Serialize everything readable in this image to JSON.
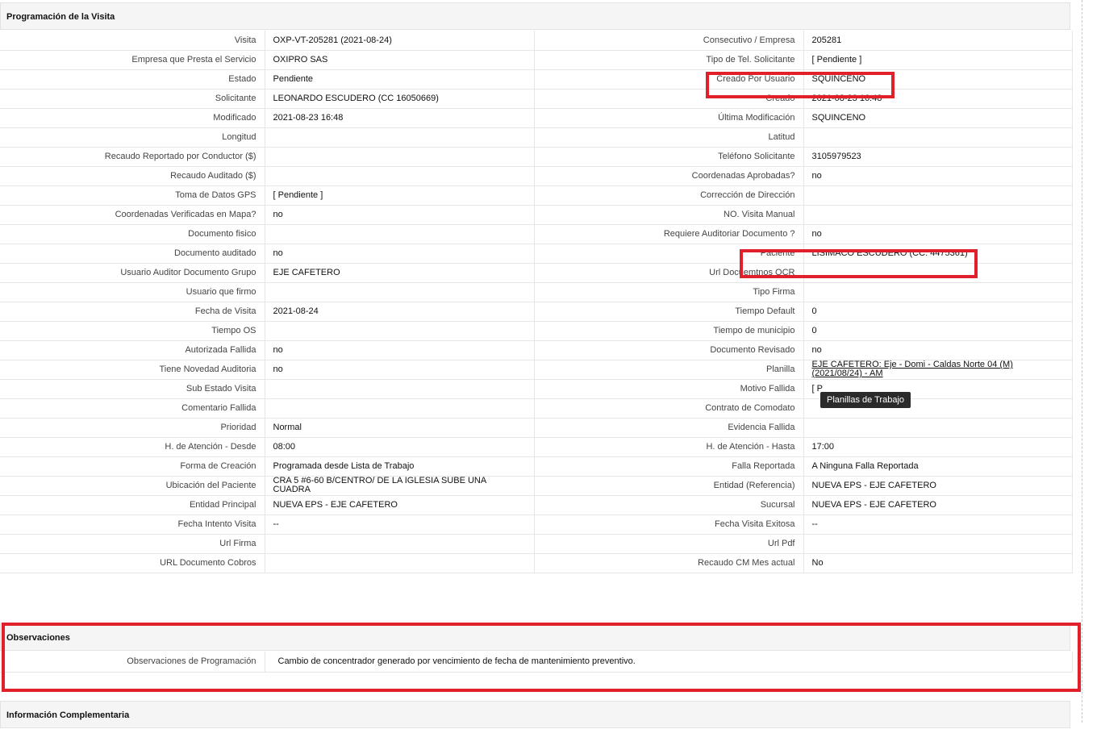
{
  "section_programacion": {
    "title": "Programación de la Visita"
  },
  "rows": [
    {
      "l1": "Visita",
      "v1": "OXP-VT-205281 (2021-08-24)",
      "l2": "Consecutivo / Empresa",
      "v2": "205281"
    },
    {
      "l1": "Empresa que Presta el Servicio",
      "v1": "OXIPRO SAS",
      "l2": "Tipo de Tel. Solicitante",
      "v2": "[ Pendiente ]"
    },
    {
      "l1": "Estado",
      "v1": "Pendiente",
      "l2": "Creado Por Usuario",
      "v2": "SQUINCENO"
    },
    {
      "l1": "Solicitante",
      "v1": "LEONARDO ESCUDERO (CC 16050669)",
      "l2": "Creado",
      "v2": "2021-08-23 16:48"
    },
    {
      "l1": "Modificado",
      "v1": "2021-08-23 16:48",
      "l2": "Última Modificación",
      "v2": " SQUINCENO"
    },
    {
      "l1": "Longitud",
      "v1": "",
      "l2": "Latitud",
      "v2": ""
    },
    {
      "l1": "Recaudo Reportado por Conductor ($)",
      "v1": "",
      "l2": "Teléfono Solicitante",
      "v2": "3105979523"
    },
    {
      "l1": "Recaudo Auditado ($)",
      "v1": "",
      "l2": "Coordenadas Aprobadas?",
      "v2": " no"
    },
    {
      "l1": "Toma de Datos GPS",
      "v1": "[ Pendiente ]",
      "l2": "Corrección de Dirección",
      "v2": ""
    },
    {
      "l1": "Coordenadas Verificadas en Mapa?",
      "v1": " no",
      "l2": "NO. Visita Manual",
      "v2": ""
    },
    {
      "l1": "Documento fisico",
      "v1": "",
      "l2": "Requiere Auditoriar Documento ?",
      "v2": " no"
    },
    {
      "l1": "Documento auditado",
      "v1": " no",
      "l2": "Paciente",
      "v2": "LISIMACO ESCUDERO (CC: 4475361)"
    },
    {
      "l1": "Usuario Auditor Documento Grupo",
      "v1": "EJE CAFETERO",
      "l2": "Url Docuemtnos OCR",
      "v2": ""
    },
    {
      "l1": "Usuario que firmo",
      "v1": "",
      "l2": "Tipo Firma",
      "v2": ""
    },
    {
      "l1": "Fecha de Visita",
      "v1": " 2021-08-24",
      "l2": "Tiempo Default",
      "v2": "0"
    },
    {
      "l1": "Tiempo OS",
      "v1": "",
      "l2": "Tiempo de municipio",
      "v2": "0"
    },
    {
      "l1": "Autorizada Fallida",
      "v1": " no",
      "l2": "Documento Revisado",
      "v2": " no"
    },
    {
      "l1": "Tiene Novedad Auditoria",
      "v1": " no",
      "l2": "Planilla",
      "v2": "EJE CAFETERO: Eje - Domi - Caldas Norte 04 (M) (2021/08/24) - AM"
    },
    {
      "l1": "Sub Estado Visita",
      "v1": "",
      "l2": "Motivo Fallida",
      "v2": "[ P"
    },
    {
      "l1": "Comentario Fallida",
      "v1": "",
      "l2": "Contrato de Comodato",
      "v2": ""
    },
    {
      "l1": "Prioridad",
      "v1": "Normal",
      "l2": "Evidencia Fallida",
      "v2": ""
    },
    {
      "l1": "H. de Atención - Desde",
      "v1": "08:00",
      "l2": "H. de Atención - Hasta",
      "v2": "17:00"
    },
    {
      "l1": "Forma de Creación",
      "v1": "Programada desde Lista de Trabajo",
      "l2": "Falla Reportada",
      "v2": "A Ninguna Falla Reportada"
    },
    {
      "l1": "Ubicación del Paciente",
      "v1": "CRA 5 #6-60 B/CENTRO/ DE LA IGLESIA SUBE UNA CUADRA",
      "l2": "Entidad (Referencia)",
      "v2": "NUEVA EPS - EJE CAFETERO"
    },
    {
      "l1": "Entidad Principal",
      "v1": "NUEVA EPS - EJE CAFETERO",
      "l2": "Sucursal",
      "v2": "NUEVA EPS - EJE CAFETERO"
    },
    {
      "l1": "Fecha Intento Visita",
      "v1": " --",
      "l2": "Fecha Visita Exitosa",
      "v2": " --"
    },
    {
      "l1": "Url Firma",
      "v1": "",
      "l2": "Url Pdf",
      "v2": ""
    },
    {
      "l1": "URL Documento Cobros",
      "v1": "",
      "l2": "Recaudo CM Mes actual",
      "v2": "No"
    }
  ],
  "tooltip": {
    "text": "Planillas de Trabajo"
  },
  "section_observaciones": {
    "title": "Observaciones",
    "label": "Observaciones de Programación",
    "value": "Cambio de concentrador generado por vencimiento de fecha de mantenimiento preventivo."
  },
  "section_info": {
    "title": "Información Complementaria"
  },
  "colors": {
    "highlight": "#e0202a",
    "header_bg": "#f5f5f5",
    "tooltip_bg": "#2b2b2b"
  }
}
